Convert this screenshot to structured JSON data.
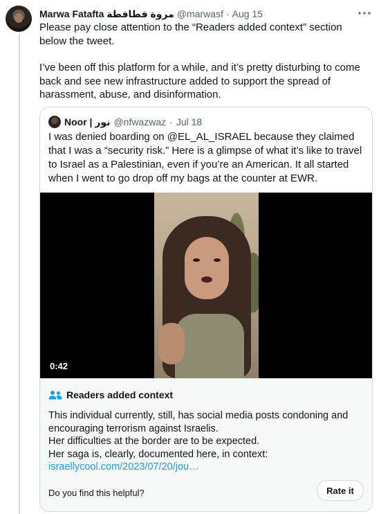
{
  "post": {
    "author_name": "Marwa Fatafta مروة فطافطة",
    "handle": "@marwasf",
    "separator": "·",
    "date": "Aug 15",
    "more_icon": "more-horizontal-icon",
    "text_paragraph_1": "Please pay close attention to the “Readers added context” section below the tweet.",
    "text_paragraph_2": "I’ve been off this platform for a while, and it’s pretty disturbing to come back and see new infrastructure added to support the spread of harassment, abuse, and disinformation."
  },
  "quoted_post": {
    "author_name": "Noor | نور",
    "handle": "@nfwazwaz",
    "separator": "·",
    "date": "Jul 18",
    "text": "I was denied boarding on @EL_AL_ISRAEL because they claimed that I was a “security risk.” Here is a glimpse of what it’s like to travel to Israel as a Palestinian, even if you’re an American. It all started when I went to go drop off my bags at the counter at EWR.",
    "video_duration": "0:42"
  },
  "context_note": {
    "title": "Readers added context",
    "icon": "people-icon",
    "line_1": "This individual currently, still, has social media posts condoning and encouraging terrorism against Israelis.",
    "line_2": "Her difficulties at the border are to be expected.",
    "line_3": "Her saga is, clearly, documented here, in context:",
    "link": "israellycool.com/2023/07/20/jou…",
    "helpful_question": "Do you find this helpful?",
    "rate_button": "Rate it"
  },
  "colors": {
    "link": "#1d9bf0",
    "secondary_text": "#536471",
    "border": "#cfd9de",
    "context_bg": "#f7f9f9"
  }
}
